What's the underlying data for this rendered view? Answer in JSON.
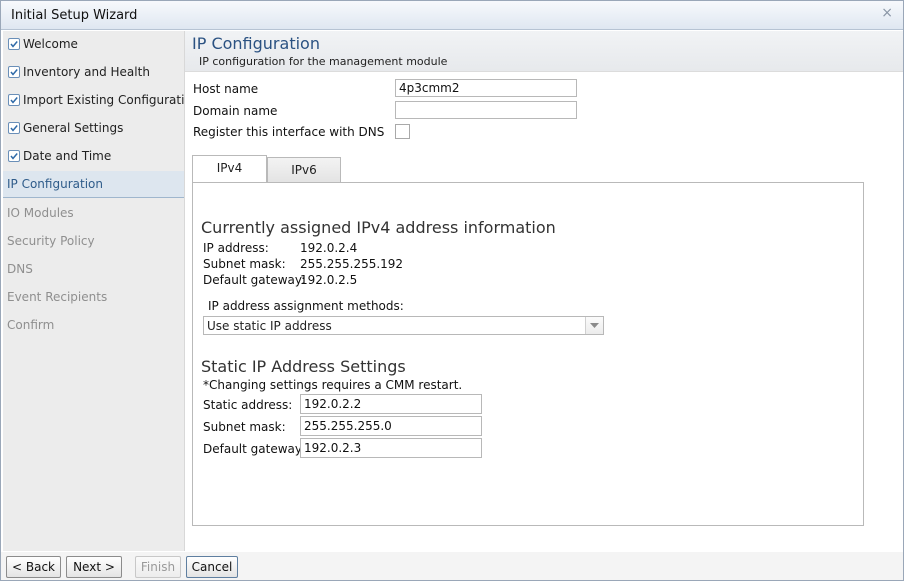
{
  "window": {
    "title": "Initial Setup Wizard",
    "close_glyph": "×"
  },
  "sidebar": {
    "items": [
      {
        "label": "Welcome",
        "state": "done"
      },
      {
        "label": "Inventory and Health",
        "state": "done"
      },
      {
        "label": "Import Existing Configuration",
        "state": "done"
      },
      {
        "label": "General Settings",
        "state": "done"
      },
      {
        "label": "Date and Time",
        "state": "done"
      },
      {
        "label": "IP Configuration",
        "state": "active"
      },
      {
        "label": "IO Modules",
        "state": "disabled"
      },
      {
        "label": "Security Policy",
        "state": "disabled"
      },
      {
        "label": "DNS",
        "state": "disabled"
      },
      {
        "label": "Event Recipients",
        "state": "disabled"
      },
      {
        "label": "Confirm",
        "state": "disabled"
      }
    ]
  },
  "page": {
    "title": "IP Configuration",
    "subtitle": "IP configuration for the management module"
  },
  "form": {
    "host_name_label": "Host name",
    "host_name_value": "4p3cmm2",
    "domain_name_label": "Domain name",
    "domain_name_value": "",
    "register_dns_label": "Register this interface with DNS",
    "register_dns_checked": false
  },
  "tabs": [
    {
      "label": "IPv4",
      "active": true
    },
    {
      "label": "IPv6",
      "active": false
    }
  ],
  "ipv4": {
    "current_title": "Currently assigned IPv4 address information",
    "ip_address_label": "IP address:",
    "ip_address_value": "192.0.2.4",
    "subnet_mask_label": "Subnet mask:",
    "subnet_mask_value": "255.255.255.192",
    "default_gateway_label": "Default gateway:",
    "default_gateway_value": "192.0.2.5",
    "methods_label": "IP address assignment methods:",
    "method_selected": "Use static IP address",
    "static_title": "Static IP Address Settings",
    "static_note": "*Changing settings requires a CMM restart.",
    "static_address_label": "Static address:",
    "static_address_value": "192.0.2.2",
    "static_subnet_label": "Subnet mask:",
    "static_subnet_value": "255.255.255.0",
    "static_gateway_label": "Default gateway:",
    "static_gateway_value": "192.0.2.3"
  },
  "footer": {
    "back_label": "< Back",
    "next_label": "Next >",
    "finish_label": "Finish",
    "cancel_label": "Cancel"
  }
}
